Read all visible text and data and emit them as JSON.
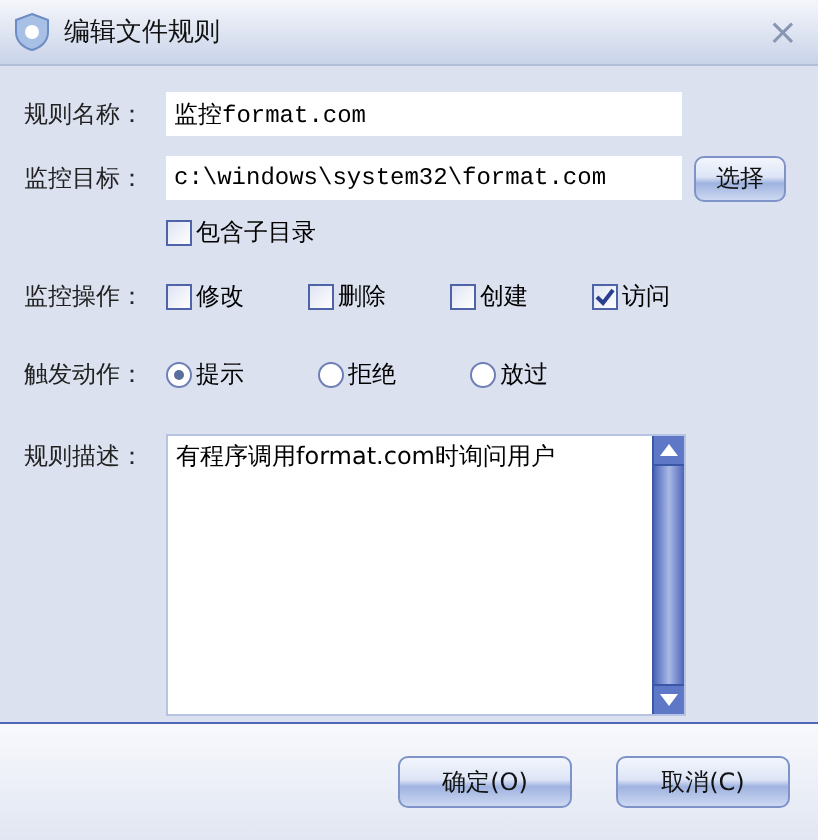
{
  "window": {
    "title": "编辑文件规则",
    "close": "×"
  },
  "fields": [
    {
      "label": "规则名称：",
      "value": "监控format.com"
    },
    {
      "label": "监控目标：",
      "value": "c:\\windows\\system32\\format.com",
      "button": "选择"
    }
  ],
  "include_subdirs": {
    "label": "包含子目录",
    "checked": false
  },
  "operations": {
    "label": "监控操作：",
    "items": [
      {
        "label": "修改",
        "checked": false
      },
      {
        "label": "删除",
        "checked": false
      },
      {
        "label": "创建",
        "checked": false
      },
      {
        "label": "访问",
        "checked": true
      }
    ]
  },
  "trigger": {
    "label": "触发动作：",
    "items": [
      {
        "label": "提示",
        "selected": true
      },
      {
        "label": "拒绝",
        "selected": false
      },
      {
        "label": "放过",
        "selected": false
      }
    ]
  },
  "description": {
    "label": "规则描述：",
    "value": "有程序调用format.com时询问用户"
  },
  "buttons": [
    "确定(O)",
    "取消(C)"
  ]
}
